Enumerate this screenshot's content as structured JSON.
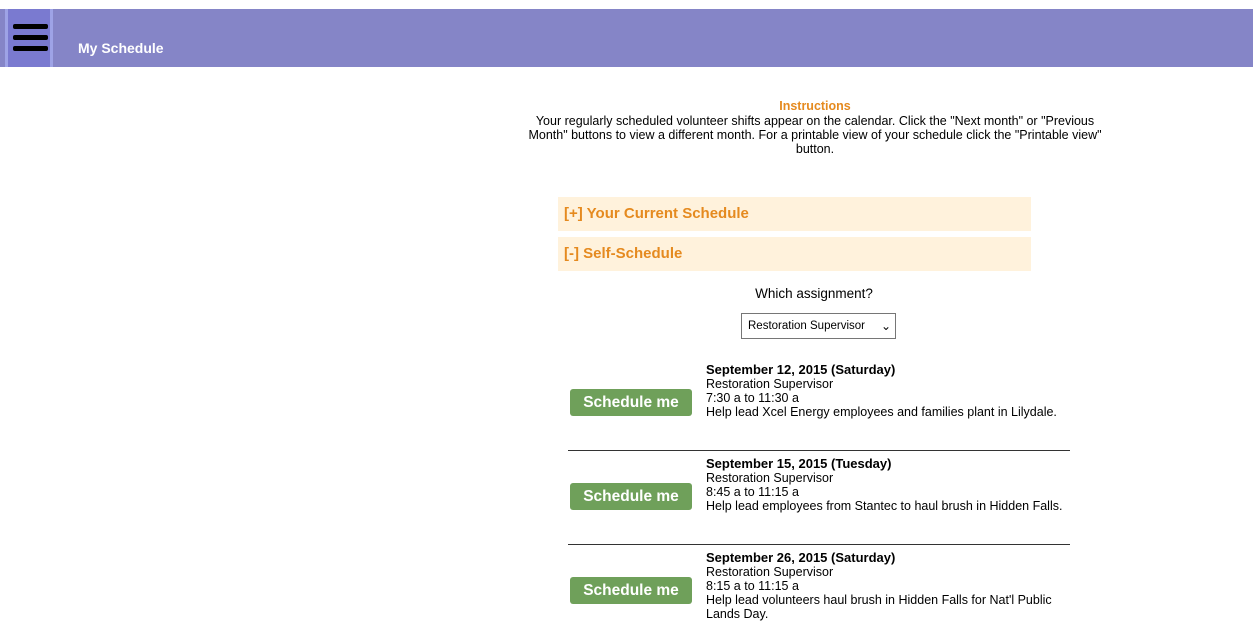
{
  "header": {
    "title": "My Schedule"
  },
  "instructions": {
    "title": "Instructions",
    "text": "Your regularly scheduled volunteer shifts appear on the calendar. Click the \"Next month\" or \"Previous Month\" buttons to view a different month. For a printable view of your schedule click the \"Printable view\" button."
  },
  "sections": {
    "current": "[+] Your Current Schedule",
    "self": "[-] Self-Schedule"
  },
  "assignment": {
    "label": "Which assignment?",
    "selected": "Restoration Supervisor"
  },
  "shifts": [
    {
      "button": "Schedule me",
      "date": "September 12, 2015 (Saturday)",
      "role": "Restoration Supervisor",
      "time": "7:30 a to 11:30 a",
      "description": "Help lead Xcel Energy employees and families plant in Lilydale."
    },
    {
      "button": "Schedule me",
      "date": "September 15, 2015 (Tuesday)",
      "role": "Restoration Supervisor",
      "time": "8:45 a to 11:15 a",
      "description": "Help lead employees from Stantec to haul brush in Hidden Falls."
    },
    {
      "button": "Schedule me",
      "date": "September 26, 2015 (Saturday)",
      "role": "Restoration Supervisor",
      "time": "8:15 a to 11:15 a",
      "description": "Help lead volunteers haul brush in Hidden Falls for Nat'l Public Lands Day."
    }
  ]
}
